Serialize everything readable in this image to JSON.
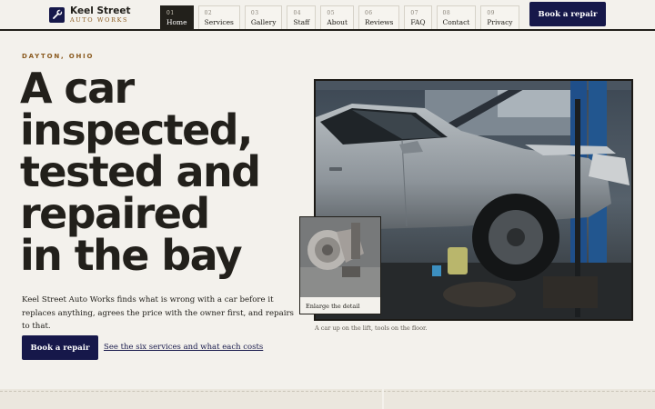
{
  "brand": {
    "name": "Keel Street",
    "subtitle": "AUTO WORKS",
    "logo_icon": "wrench-icon",
    "color": "#16184a"
  },
  "nav": {
    "items": [
      {
        "num": "01",
        "label": "Home",
        "active": true
      },
      {
        "num": "02",
        "label": "Services"
      },
      {
        "num": "03",
        "label": "Gallery"
      },
      {
        "num": "04",
        "label": "Staff"
      },
      {
        "num": "05",
        "label": "About"
      },
      {
        "num": "06",
        "label": "Reviews"
      },
      {
        "num": "07",
        "label": "FAQ"
      },
      {
        "num": "08",
        "label": "Contact"
      },
      {
        "num": "09",
        "label": "Privacy"
      }
    ],
    "cta": "Book a repair"
  },
  "hero": {
    "eyebrow": "DAYTON, OHIO",
    "headline": [
      "A car",
      "inspected,",
      "tested and",
      "repaired",
      "in the bay"
    ],
    "intro": "Keel Street Auto Works finds what is wrong with a car before it replaces anything, agrees the price with the owner first, and repairs to that.",
    "cta_primary": "Book a repair",
    "cta_secondary": "See the six services and what each costs"
  },
  "photo": {
    "caption": "A car up on the lift, tools on the floor.",
    "detail_label": "Enlarge the detail"
  },
  "colors": {
    "background": "#f3f1ec",
    "ink": "#22201b",
    "accent": "#8a5a1f",
    "button": "#16184a"
  }
}
